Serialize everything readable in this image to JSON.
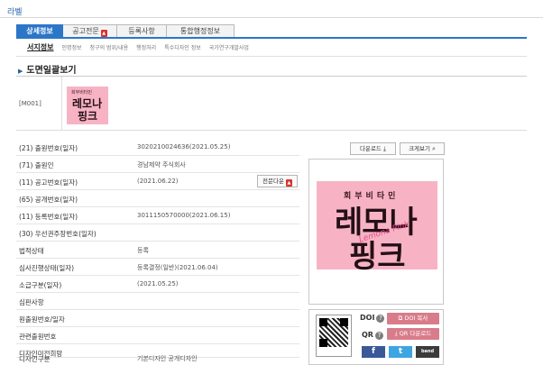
{
  "window": {
    "title": "라벨"
  },
  "tabs": [
    {
      "label": "상세정보"
    },
    {
      "label": "공고전문"
    },
    {
      "label": "등록사항"
    },
    {
      "label": "통합행정정보"
    }
  ],
  "subtabs": [
    {
      "label": "서지정보"
    },
    {
      "label": "인명정보"
    },
    {
      "label": "청구의 범위/내용"
    },
    {
      "label": "행정처리"
    },
    {
      "label": "특수디자인 정보"
    },
    {
      "label": "국가연구개발사업"
    }
  ],
  "section": {
    "title": "도면일괄보기",
    "arrow": "▶"
  },
  "thumbnail": {
    "code": "[M001]",
    "image_text": {
      "small": "회부비타민",
      "line1": "레모나",
      "line2": "핑크"
    }
  },
  "fields": [
    {
      "label": "(21) 출원번호(일자)",
      "value": "3020210024636(2021.05.25)"
    },
    {
      "label": "(71) 출원인",
      "value": "경남제약 주식회사"
    },
    {
      "label": "(11) 공고번호(일자)",
      "value": "(2021.06.22)",
      "button": "전문다운"
    },
    {
      "label": "(65) 공개번호(일자)",
      "value": ""
    },
    {
      "label": "(11) 등록번호(일자)",
      "value": "3011150570000(2021.06.15)"
    },
    {
      "label": "(30) 우선권주장번호(일자)",
      "value": ""
    },
    {
      "label": "법적상태",
      "value": "등록"
    },
    {
      "label": "심사진행상태(일자)",
      "value": "등록결정(일반)(2021.06.04)"
    },
    {
      "label": "소급구분(일자)",
      "value": "(2021.05.25)"
    },
    {
      "label": "심판사항",
      "value": ""
    },
    {
      "label": "원출원번호/일자",
      "value": ""
    },
    {
      "label": "관련출원번호",
      "value": ""
    },
    {
      "label": "디자인미전희망",
      "value": ""
    },
    {
      "label": "디자인구분",
      "value": "기본디자인 공개디자인"
    }
  ],
  "viewer": {
    "download_label": "다운로드",
    "enlarge_label": "크게보기",
    "image_text": {
      "small": "회부비타민",
      "line1": "레모나",
      "line2": "핑크",
      "script": "Lemona Pink"
    }
  },
  "share": {
    "doi_label": "DOI",
    "qr_label": "QR",
    "help_glyph": "?",
    "doi_copy": "DOI 복사",
    "qr_download": "QR 다운로드",
    "facebook": "f",
    "twitter": "t",
    "band": "band"
  },
  "colors": {
    "accent": "#2c76c7",
    "pink_button": "#d97c8a",
    "pdf": "#d9332b",
    "facebook": "#3b5998",
    "twitter": "#3ea5e3",
    "band": "#3b3b3b"
  }
}
